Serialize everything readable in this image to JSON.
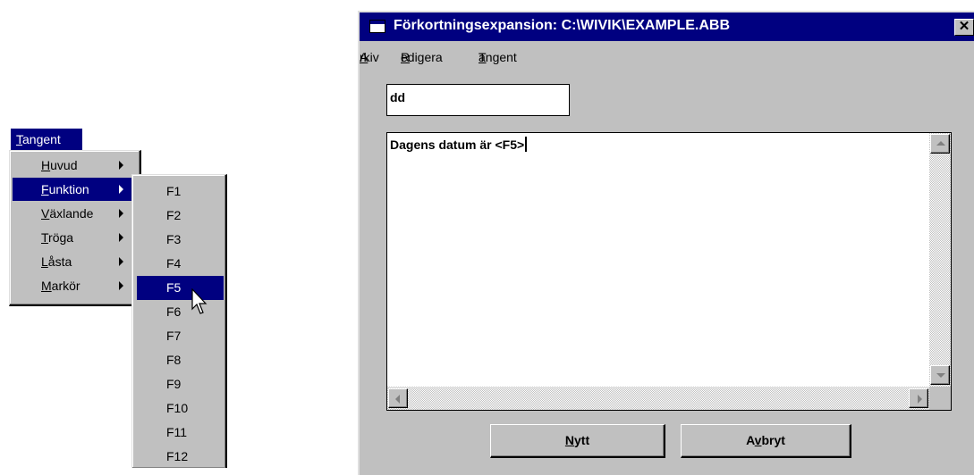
{
  "left_menu": {
    "menubar_item": {
      "mnemonic": "T",
      "rest": "angent"
    },
    "submenu_items": [
      {
        "mnemonic": "H",
        "rest": "uvud"
      },
      {
        "mnemonic": "F",
        "rest": "unktion"
      },
      {
        "mnemonic": "V",
        "rest": "äxlande"
      },
      {
        "mnemonic": "T",
        "rest": "röga"
      },
      {
        "mnemonic": "L",
        "rest": "åsta"
      },
      {
        "mnemonic": "M",
        "rest": "arkör"
      }
    ],
    "function_keys": [
      "F1",
      "F2",
      "F3",
      "F4",
      "F5",
      "F6",
      "F7",
      "F8",
      "F9",
      "F10",
      "F11",
      "F12"
    ]
  },
  "window": {
    "title": "Förkortningsexpansion: C:\\WIVIK\\EXAMPLE.ABB",
    "close_glyph": "✕",
    "menubar": [
      {
        "mnemonic": "A",
        "rest": "rkiv"
      },
      {
        "mnemonic": "R",
        "rest": "edigera"
      },
      {
        "mnemonic": "T",
        "rest": "angent"
      }
    ],
    "abbreviation_value": "dd",
    "expansion_text": "Dagens datum är <F5>",
    "buttons": {
      "new": {
        "before": "",
        "mnemonic": "N",
        "after": "ytt"
      },
      "cancel": {
        "before": "A",
        "mnemonic": "v",
        "after": "bryt"
      }
    }
  },
  "colors": {
    "highlight": "#000080",
    "face": "#c0c0c0"
  }
}
